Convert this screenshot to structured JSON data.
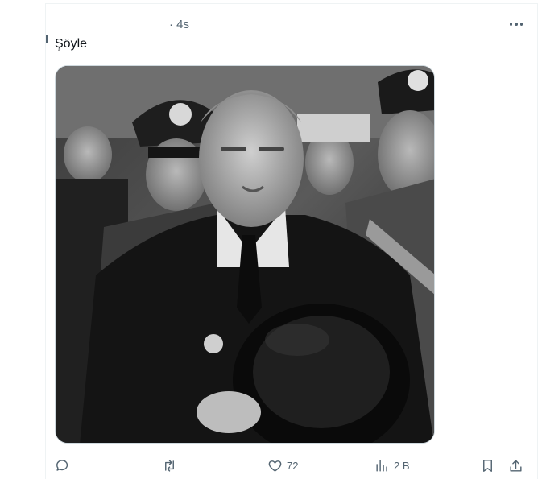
{
  "tweet": {
    "time": "· 4s",
    "text": "Şöyle",
    "image_alt": "Siyah beyaz fotoğraf"
  },
  "actions": {
    "reply_count": "",
    "retweet_count": "",
    "like_count": "72",
    "views_count": "2 B"
  },
  "icons": [
    "more-icon",
    "reply-icon",
    "retweet-icon",
    "like-icon",
    "views-icon",
    "bookmark-icon",
    "share-icon"
  ],
  "colors": {
    "secondary_text": "#536471",
    "text": "#0f1419",
    "border": "#cfd9de"
  }
}
